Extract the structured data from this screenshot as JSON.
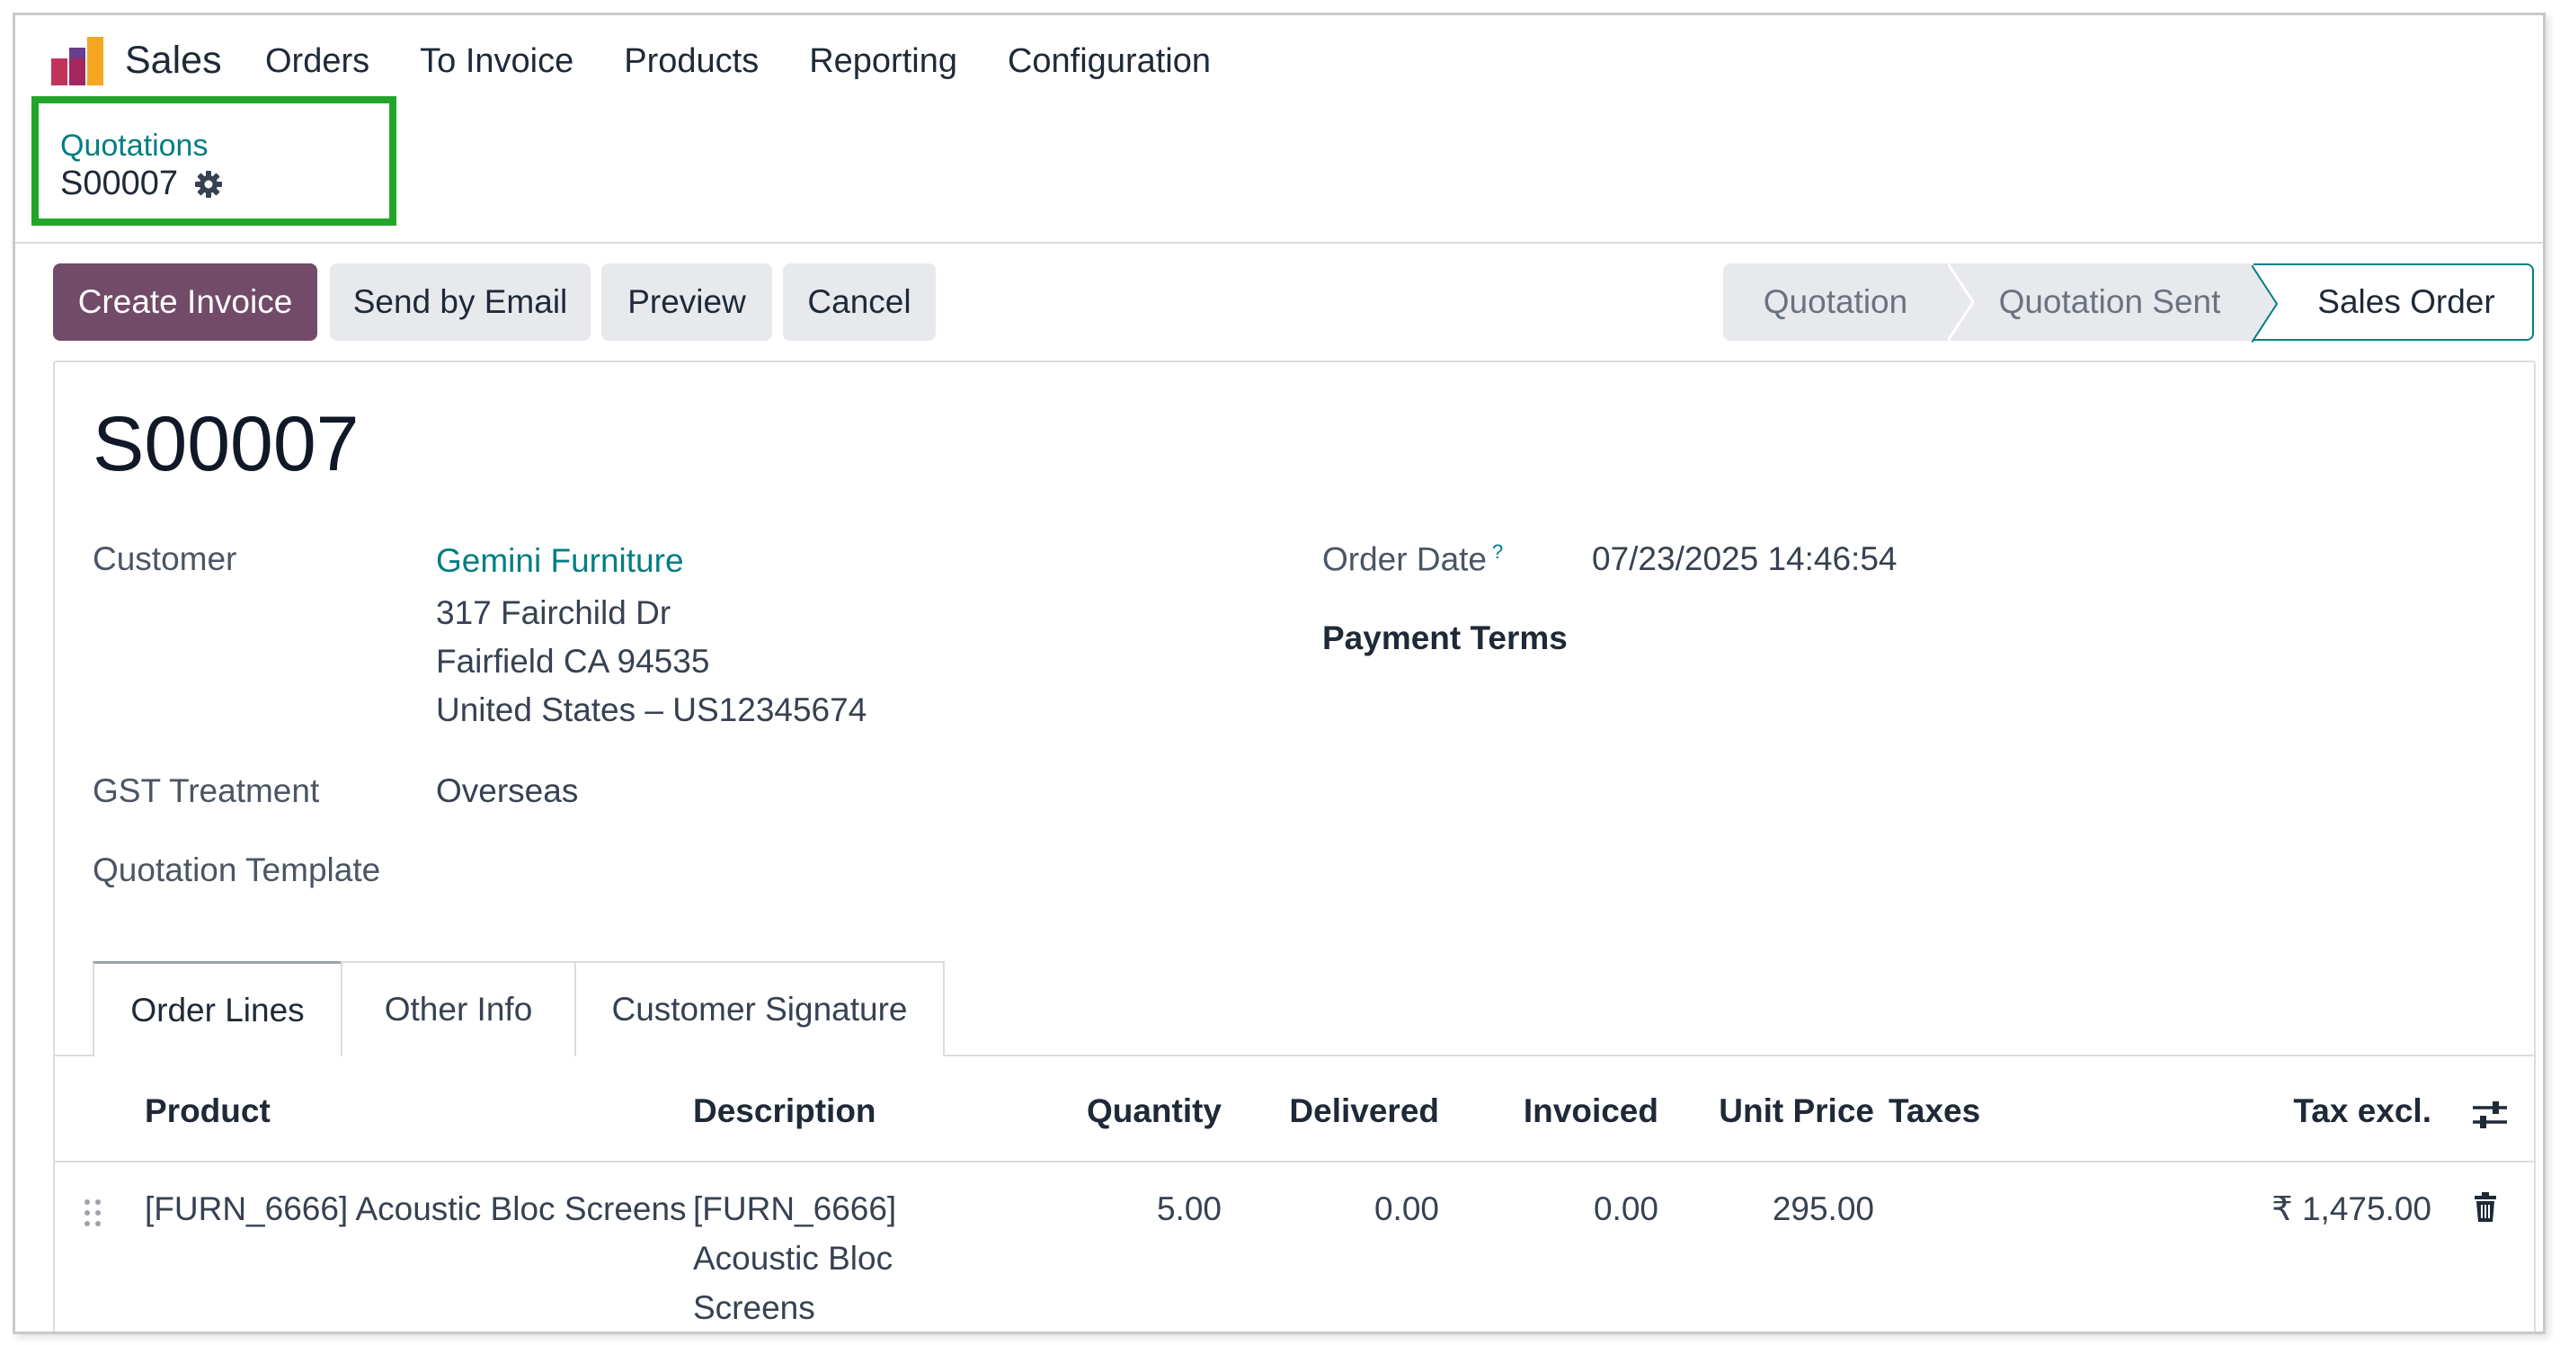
{
  "app": {
    "name": "Sales"
  },
  "menu": [
    "Orders",
    "To Invoice",
    "Products",
    "Reporting",
    "Configuration"
  ],
  "breadcrumb": {
    "parent": "Quotations",
    "current": "S00007"
  },
  "actions": {
    "create_invoice": "Create Invoice",
    "send_by_email": "Send by Email",
    "preview": "Preview",
    "cancel": "Cancel"
  },
  "status": {
    "stages": [
      "Quotation",
      "Quotation Sent",
      "Sales Order"
    ],
    "active": "Sales Order"
  },
  "record": {
    "name": "S00007",
    "customer_label": "Customer",
    "customer_name": "Gemini Furniture",
    "address_line1": "317 Fairchild Dr",
    "address_line2": "Fairfield CA 94535",
    "address_line3": "United States – US12345674",
    "gst_label": "GST Treatment",
    "gst_value": "Overseas",
    "template_label": "Quotation Template",
    "order_date_label": "Order Date",
    "order_date_help": "?",
    "order_date_value": "07/23/2025 14:46:54",
    "payment_terms_label": "Payment Terms"
  },
  "tabs": [
    "Order Lines",
    "Other Info",
    "Customer Signature"
  ],
  "table": {
    "headers": {
      "product": "Product",
      "description": "Description",
      "quantity": "Quantity",
      "delivered": "Delivered",
      "invoiced": "Invoiced",
      "unit_price": "Unit Price",
      "taxes": "Taxes",
      "tax_excl": "Tax excl."
    },
    "rows": [
      {
        "product": "[FURN_6666] Acoustic Bloc Screens",
        "description_1": "[FURN_6666]",
        "description_2": "Acoustic Bloc",
        "description_3": "Screens",
        "quantity": "5.00",
        "delivered": "0.00",
        "invoiced": "0.00",
        "unit_price": "295.00",
        "taxes": "",
        "tax_excl": "₹ 1,475.00"
      }
    ]
  },
  "colors": {
    "primary": "#714b67",
    "link": "#017e84",
    "highlight": "#22a62a"
  }
}
